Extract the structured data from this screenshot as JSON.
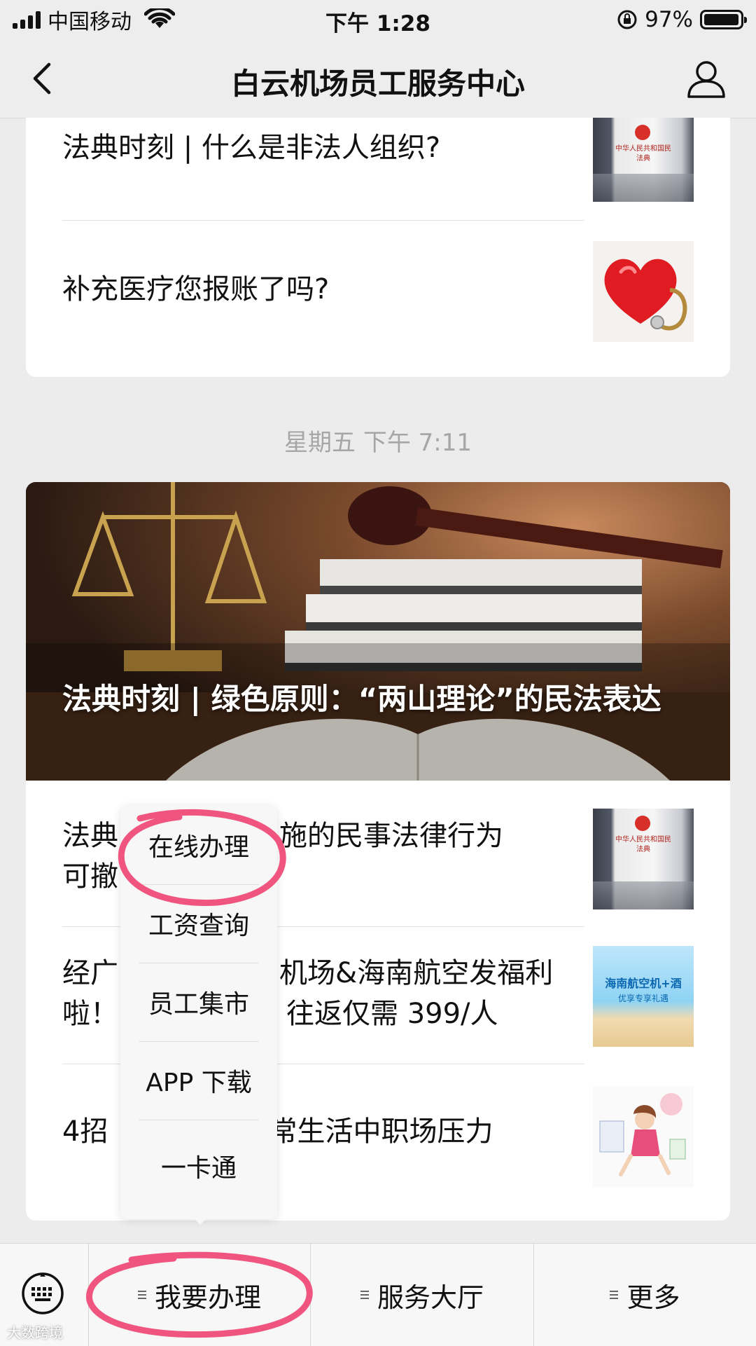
{
  "status_bar": {
    "carrier": "中国移动",
    "time": "下午 1:28",
    "battery_percent": "97%",
    "battery_level": 0.97
  },
  "nav": {
    "title": "白云机场员工服务中心",
    "back_icon": "chevron-left-icon",
    "profile_icon": "user-icon"
  },
  "articles_top": [
    {
      "title": "法典时刻 | 什么是非法人组织?",
      "thumb": "civil-code-book"
    },
    {
      "title": "补充医疗您报账了吗?",
      "thumb": "heart-stethoscope"
    }
  ],
  "timestamp": "星期五 下午 7:11",
  "hero": {
    "title": "法典时刻 | 绿色原则：“两山理论”的民法表达",
    "image": "gavel-scales-books"
  },
  "articles_bottom": [
    {
      "title": "法典时刻 | 胁迫实施的民事法律行为可撤销",
      "title_visible": [
        "法典",
        "作实施的民事法律行为",
        "可撤"
      ],
      "thumb": "civil-code-book"
    },
    {
      "title_visible": [
        "经广",
        "机场&海南航空发福利",
        "啦！",
        "往返仅需 399/人"
      ],
      "thumb": "hainan-airlines",
      "thumb_text": [
        "海南航空机+酒",
        "优享专享礼遇"
      ]
    },
    {
      "title_visible": [
        "4招",
        "常生活中职场压力"
      ],
      "thumb": "stress-illustration"
    }
  ],
  "thumb_book_text": "中华人民共和国民法典",
  "popup_menu": {
    "items": [
      "在线办理",
      "工资查询",
      "员工集市",
      "APP 下载",
      "一卡通"
    ]
  },
  "bottom_bar": {
    "keyboard_icon": "keyboard-icon",
    "tabs": [
      "我要办理",
      "服务大厅",
      "更多"
    ]
  },
  "colors": {
    "annotation": "#f0557f",
    "background": "#ececec",
    "timestamp": "#a6a6a6"
  },
  "watermark": "大数跨境"
}
